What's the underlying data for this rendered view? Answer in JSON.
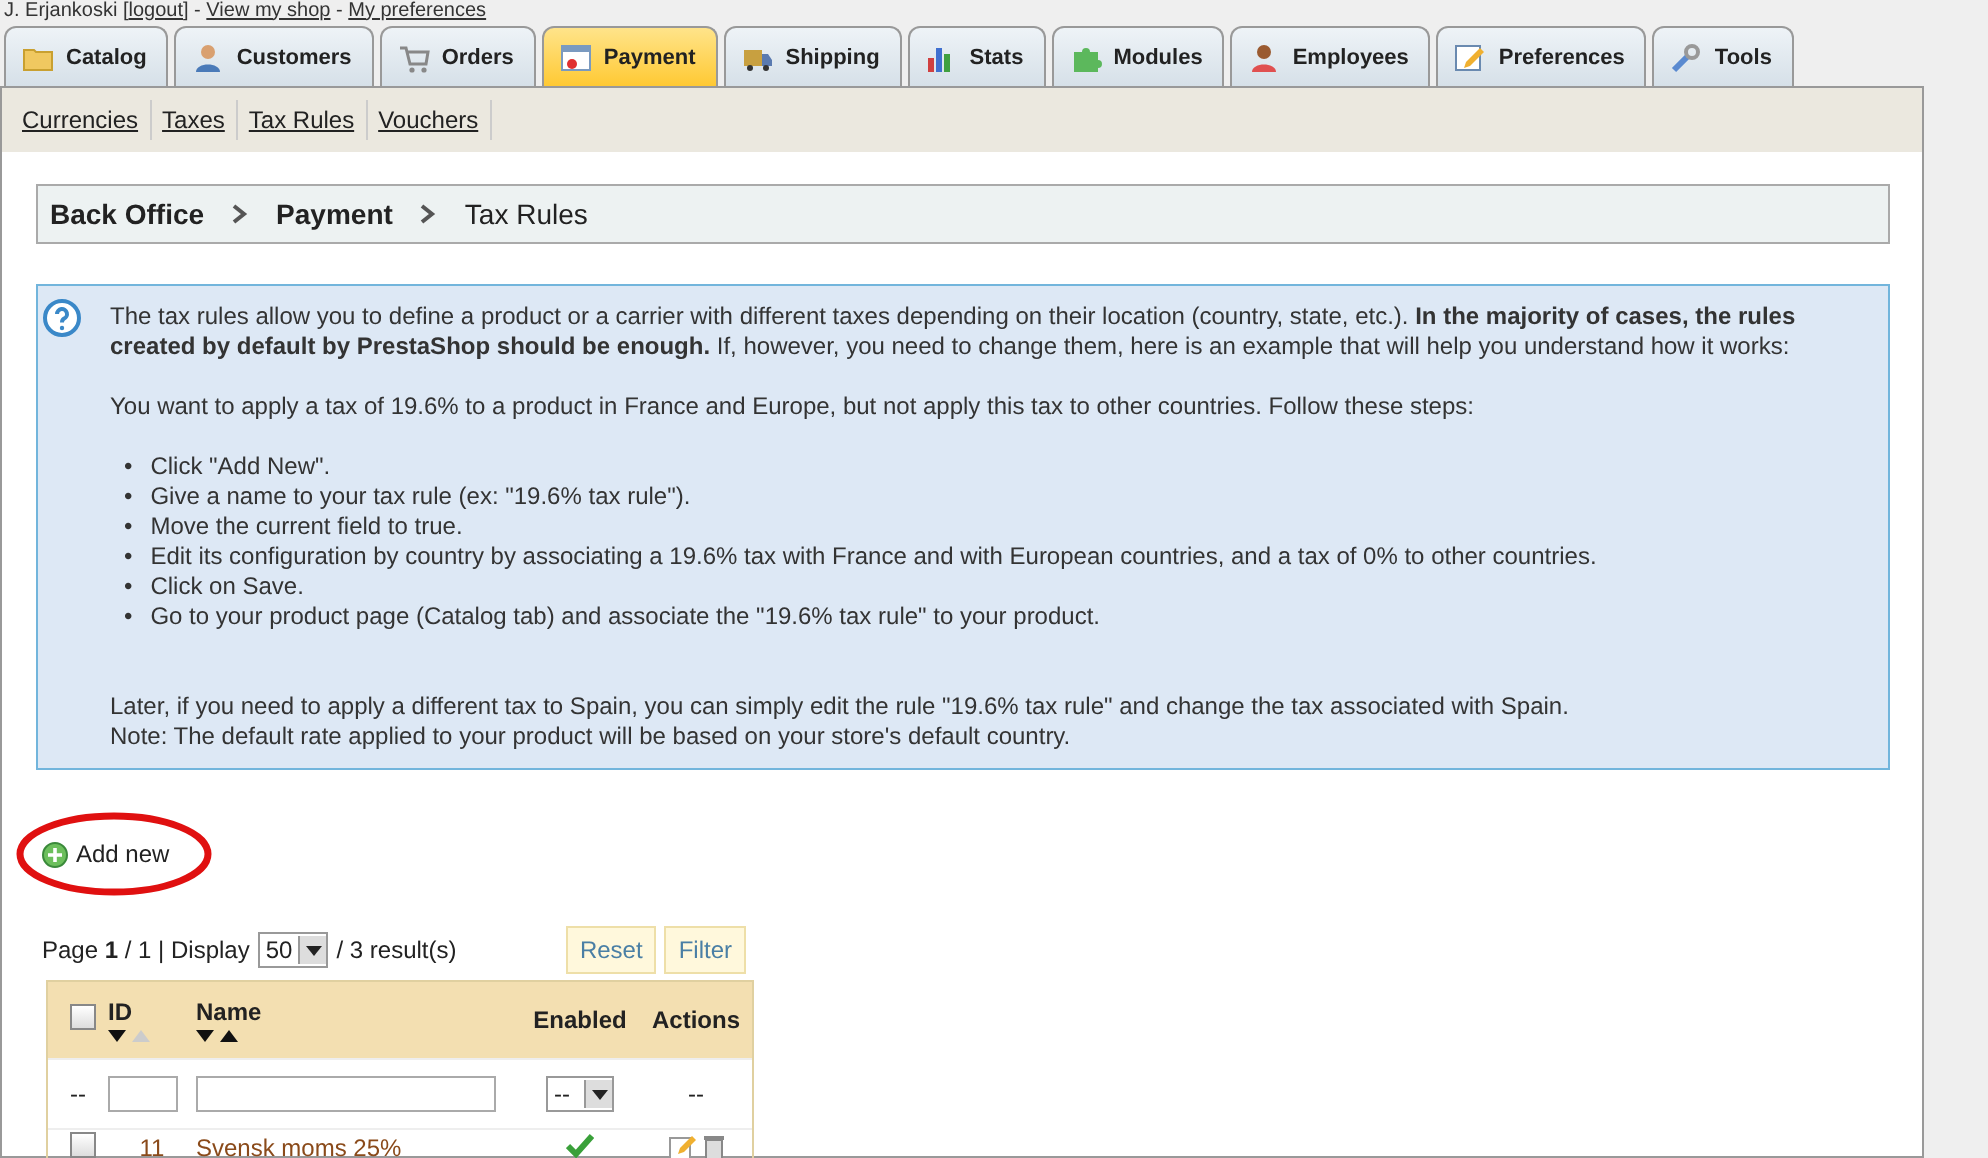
{
  "header": {
    "user": "J. Erjankoski [",
    "logout": "logout",
    "sep1": "] - ",
    "view_shop": "View my shop",
    "sep2": " - ",
    "preferences": "My preferences"
  },
  "tabs": [
    {
      "label": "Catalog",
      "kind": "folder",
      "selected": false
    },
    {
      "label": "Customers",
      "kind": "person",
      "selected": false
    },
    {
      "label": "Orders",
      "kind": "cart",
      "selected": false
    },
    {
      "label": "Payment",
      "kind": "card",
      "selected": true
    },
    {
      "label": "Shipping",
      "kind": "truck",
      "selected": false
    },
    {
      "label": "Stats",
      "kind": "bars",
      "selected": false
    },
    {
      "label": "Modules",
      "kind": "puzzle",
      "selected": false
    },
    {
      "label": "Employees",
      "kind": "employee",
      "selected": false
    },
    {
      "label": "Preferences",
      "kind": "pencil",
      "selected": false
    },
    {
      "label": "Tools",
      "kind": "wrench",
      "selected": false
    }
  ],
  "subtabs": [
    "Currencies",
    "Taxes",
    "Tax Rules",
    "Vouchers"
  ],
  "breadcrumb": [
    {
      "label": "Back Office",
      "current": false
    },
    {
      "label": "Payment",
      "current": false
    },
    {
      "label": "Tax Rules",
      "current": true
    }
  ],
  "info": {
    "intro": "The tax rules allow you to define a product or a carrier with different taxes depending on their location (country, state, etc.). **In the majority of cases, the rules created by default by PrestaShop should be enough.** If, however, you need to change them, here is an example that will help you understand how it works:",
    "example": "You want to apply a tax of 19.6% to a product in France and Europe, but not apply this tax to other countries. Follow these steps:",
    "marker": "•",
    "steps": [
      "Click \"Add New\".",
      "Give a name to your tax rule (ex: \"19.6% tax rule\").",
      "Move the current field to true.",
      "Edit its configuration by country by associating a 19.6% tax with France and with European countries, and a tax of 0% to other countries.",
      "Click on Save.",
      "Go to your product page (Catalog tab) and associate the \"19.6% tax rule\" to your product."
    ],
    "notes": [
      "Later, if you need to apply a different tax to Spain, you can simply edit the rule \"19.6% tax rule\" and change the tax associated with Spain.",
      "Note: The default rate applied to your product will be based on your store's default country."
    ]
  },
  "add_new": "Add new",
  "pagination": {
    "text": "Page **1** / 1 | Display",
    "per_page": "50",
    "results": "/ 3 result(s)"
  },
  "buttons": [
    "Reset",
    "Filter"
  ],
  "table": {
    "select_all_checked": false,
    "columns": [
      {
        "label": "ID",
        "sortable": true
      },
      {
        "label": "Name",
        "sortable": true
      },
      {
        "label": "Enabled",
        "sortable": false
      },
      {
        "label": "Actions",
        "sortable": false
      }
    ],
    "filter": {
      "first": "--",
      "enabled": "--",
      "actions": "--"
    },
    "rows": [
      {
        "checked": false,
        "id": "11",
        "name": "Svensk moms 25%",
        "enabled": true
      }
    ]
  }
}
